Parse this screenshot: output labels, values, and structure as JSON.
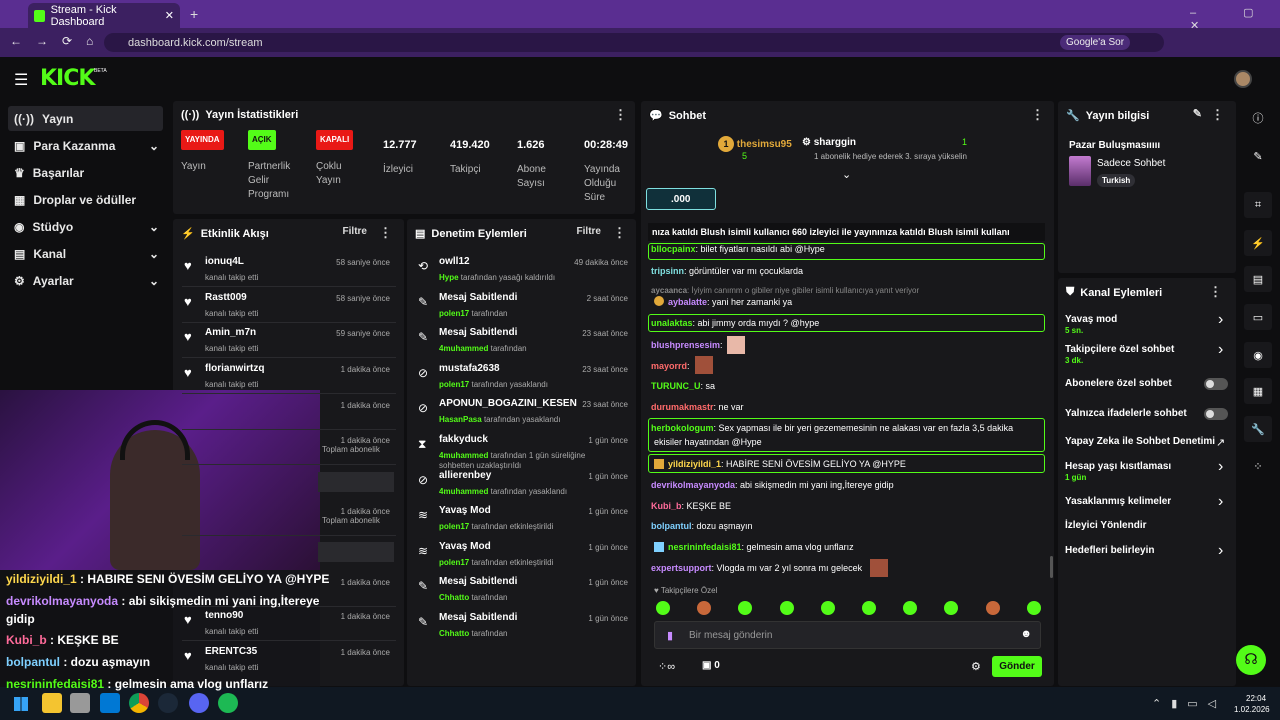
{
  "browser": {
    "tab_title": "Stream - Kick Dashboard",
    "url": "dashboard.kick.com/stream",
    "google_btn": "Google'a Sor"
  },
  "logo": "KICK",
  "logo_beta": "BETA",
  "sidebar": {
    "items": [
      {
        "label": "Yayın"
      },
      {
        "label": "Para Kazanma"
      },
      {
        "label": "Başarılar"
      },
      {
        "label": "Droplar ve ödüller"
      },
      {
        "label": "Stüdyo"
      },
      {
        "label": "Kanal"
      },
      {
        "label": "Ayarlar"
      }
    ]
  },
  "stats": {
    "title": "Yayın İstatistikleri",
    "live_badge": "YAYINDA",
    "live_label": "Yayın",
    "on_badge": "AÇIK",
    "on_label": "Partnerlik Gelir Programı",
    "off_badge": "KAPALI",
    "off_label": "Çoklu Yayın",
    "viewers": "12.777",
    "viewers_label": "İzleyici",
    "followers": "419.420",
    "followers_label": "Takipçi",
    "subs": "1.626",
    "subs_label": "Abone Sayısı",
    "duration": "00:28:49",
    "duration_label": "Yayında Olduğu Süre"
  },
  "activity": {
    "title": "Etkinlik Akışı",
    "filter": "Filtre",
    "items": [
      {
        "name": "ionuq4L",
        "sub": "kanalı takip etti",
        "time": "58 saniye önce"
      },
      {
        "name": "Rastt009",
        "sub": "kanalı takip etti",
        "time": "58 saniye önce"
      },
      {
        "name": "Amin_m7n",
        "sub": "kanalı takip etti",
        "time": "59 saniye önce"
      },
      {
        "name": "florianwirtzq",
        "sub": "kanalı takip etti",
        "time": "1 dakika önce"
      },
      {
        "time": "1 dakika önce"
      },
      {
        "time": "1 dakika önce",
        "sub": "Toplam abonelik"
      },
      {
        "time": "1 dakika önce",
        "sub": "Toplam abonelik"
      },
      {
        "time": "1 dakika önce"
      },
      {
        "name": "tenno90",
        "sub": "kanalı takip etti",
        "time": "1 dakika önce"
      },
      {
        "name": "ERENTC35",
        "sub": "kanalı takip etti",
        "time": "1 dakika önce"
      }
    ]
  },
  "moderation": {
    "title": "Denetim Eylemleri",
    "filter": "Filtre",
    "items": [
      {
        "name": "owll12",
        "by": "Hype",
        "suffix": "tarafından yasağı kaldırıldı",
        "time": "49 dakika önce"
      },
      {
        "name": "Mesaj Sabitlendi",
        "by": "polen17",
        "suffix": "tarafından",
        "time": "2 saat önce"
      },
      {
        "name": "Mesaj Sabitlendi",
        "by": "4muhammed",
        "suffix": "tarafından",
        "time": "23 saat önce"
      },
      {
        "name": "mustafa2638",
        "by": "polen17",
        "suffix": "tarafından yasaklandı",
        "time": "23 saat önce"
      },
      {
        "name": "APONUN_BOGAZINI_KESEN",
        "by": "HasanPasa",
        "suffix": "tarafından yasaklandı",
        "time": "23 saat önce"
      },
      {
        "name": "fakkyduck",
        "by": "4muhammed",
        "suffix": "tarafından 1 gün süreliğine sohbetten uzaklaştırıldı",
        "time": "1 gün önce"
      },
      {
        "name": "allierenbey",
        "by": "4muhammed",
        "suffix": "tarafından yasaklandı",
        "time": "1 gün önce"
      },
      {
        "name": "Yavaş Mod",
        "by": "polen17",
        "suffix": "tarafından etkinleştirildi",
        "time": "1 gün önce"
      },
      {
        "name": "Yavaş Mod",
        "by": "polen17",
        "suffix": "tarafından etkinleştirildi",
        "time": "1 gün önce"
      },
      {
        "name": "Mesaj Sabitlendi",
        "by": "Chhatto",
        "suffix": "tarafından",
        "time": "1 gün önce"
      },
      {
        "name": "Mesaj Sabitlendi",
        "by": "Chhatto",
        "suffix": "tarafından",
        "time": "1 gün önce"
      }
    ]
  },
  "chat": {
    "title": "Sohbet",
    "top1": "thesimsu95",
    "top1_count": "5",
    "top2": "sharggin",
    "top2_count": "1",
    "top2_note": "1 abonelik hediye ederek 3. sıraya yükselin",
    "viewer_chip": ".000",
    "ticker": "nıza katıldı  Blush isimli kullanıcı 660 izleyici ile yayınınıza katıldı  Blush isimli kullanı",
    "messages": [
      {
        "user": "bllocpainx",
        "text": ": bilet fiyatları nasıldı abi @Hype",
        "color": "#53fc18"
      },
      {
        "user": "tripsinn",
        "text": ": görüntüler var mı çocuklarda",
        "color": "#7fe0e0"
      },
      {
        "user": "aycaanca",
        "text": ": İyiyim canımm o gibiler niye gibiler isimli kullanıcıya yanıt veriyor",
        "color": "#888"
      },
      {
        "user": "aybalatte",
        "text": ": yani her zamanki ya",
        "color": "#c78bff"
      },
      {
        "user": "unalaktas",
        "text": ": abi jimmy orda mıydı ? @hype",
        "color": "#53fc18"
      },
      {
        "user": "blushprensesim",
        "text": ":",
        "color": "#c78bff"
      },
      {
        "user": "mayorrd",
        "text": ":",
        "color": "#ff6b6b"
      },
      {
        "user": "TURUNC_U",
        "text": ": sa",
        "color": "#53fc18"
      },
      {
        "user": "durumakmastr",
        "text": ": ne var",
        "color": "#ff6b6b"
      },
      {
        "user": "herbokologum",
        "text": ": Sex yapması ile bir yeri gezememesinin ne alakası var en fazla 3,5 dakika",
        "color": "#53fc18"
      },
      {
        "user": "",
        "text": "ekisiler hayatından @Hype",
        "color": "#fff"
      },
      {
        "user": "yildiziyildi_1",
        "text": ": HABİRE SENİ ÖVESİM GELİYO YA @HYPE",
        "color": "#ffd84d"
      },
      {
        "user": "devrikolmayanyoda",
        "text": ": abi sikişmedin mi yani ing,İtereye gidip",
        "color": "#c78bff"
      },
      {
        "user": "Kubi_b",
        "text": ": KEŞKE BE",
        "color": "#ff6b9a"
      },
      {
        "user": "bolpantul",
        "text": ": dozu aşmayın",
        "color": "#7fd0ff"
      },
      {
        "user": "nesrininfedaisi81",
        "text": ": gelmesin ama vlog unflarız",
        "color": "#53fc18"
      },
      {
        "user": "expertsupport",
        "text": ": Vlogda mı var 2 yıl sonra mı gelecek",
        "color": "#c78bff"
      }
    ],
    "followers_only": "Takipçilere Özel",
    "input_placeholder": "Bir mesaj gönderin",
    "points": "0",
    "send": "Gönder"
  },
  "stream_info": {
    "title": "Yayın bilgisi",
    "stream_title": "Pazar Buluşmasııııı",
    "category": "Sadece Sohbet",
    "tag": "Turkish"
  },
  "channel_actions": {
    "title": "Kanal Eylemleri",
    "items": [
      {
        "label": "Yavaş mod",
        "sub": "5 sn."
      },
      {
        "label": "Takipçilere özel sohbet",
        "sub": "3 dk."
      },
      {
        "label": "Abonelere özel sohbet"
      },
      {
        "label": "Yalnızca ifadelerle sohbet"
      },
      {
        "label": "Yapay Zeka ile Sohbet Denetimi"
      },
      {
        "label": "Hesap yaşı kısıtlaması",
        "sub": "1 gün"
      },
      {
        "label": "Yasaklanmış kelimeler"
      },
      {
        "label": "İzleyici Yönlendir"
      },
      {
        "label": "Hedefleri belirleyin"
      }
    ]
  },
  "overlay": [
    {
      "user": "yildiziyildi_1",
      "text": " : HABIRE SENI ÖVESİM GELİYO YA @HYPE",
      "color": "#ffd84d"
    },
    {
      "user": "devrikolmayanyoda",
      "text": " : abi sikişmedin mi yani ing,İtereye",
      "color": "#c78bff"
    },
    {
      "user": "",
      "text": "gidip",
      "color": "#fff"
    },
    {
      "user": "Kubi_b",
      "text": " : KEŞKE BE",
      "color": "#ff6b9a"
    },
    {
      "user": "bolpantul",
      "text": " : dozu aşmayın",
      "color": "#7fd0ff"
    },
    {
      "user": "nesrininfedaisi81",
      "text": " : gelmesin ama vlog unflarız",
      "color": "#53fc18"
    }
  ],
  "taskbar": {
    "time": "22:04",
    "date": "1.02.2026"
  },
  "colors": {
    "accent": "#53fc18",
    "panel": "#18181b",
    "live": "#e91916"
  }
}
